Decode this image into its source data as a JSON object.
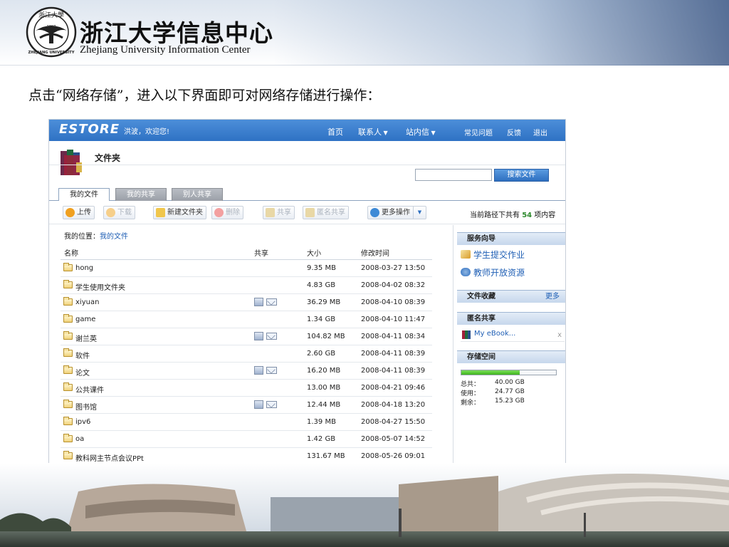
{
  "header": {
    "title_cn": "浙江大学信息中心",
    "title_en": "Zhejiang University Information Center",
    "logo": {
      "text": "浙江大學",
      "year": "1897",
      "ring_text": "ZHEJIANG UNIVERSITY"
    }
  },
  "intro_text": "点击“网络存储”，进入以下界面即可对网络存储进行操作：",
  "estore": {
    "logo": "ESTORE",
    "greeting": "洪波，欢迎您!",
    "nav": {
      "home": "首页",
      "contacts": "联系人",
      "messages": "站内信",
      "faq": "常见问题",
      "feedback": "反馈",
      "logout": "退出"
    },
    "folder_title": "文件夹",
    "search": {
      "value": "",
      "button": "搜索文件"
    },
    "tabs": [
      {
        "label": "我的文件",
        "active": true
      },
      {
        "label": "我的共享",
        "active": false
      },
      {
        "label": "别人共享",
        "active": false
      }
    ],
    "toolbar": {
      "upload": "上传",
      "download": "下载",
      "new_folder": "新建文件夹",
      "delete": "删除",
      "share": "共享",
      "anon_share": "匿名共享",
      "more_ops": "更多操作"
    },
    "path_count": {
      "prefix": "当前路径下共有",
      "count": "54",
      "suffix": "项内容"
    },
    "location": {
      "label": "我的位置：",
      "path": "我的文件"
    },
    "columns": {
      "name": "名称",
      "share": "共享",
      "size": "大小",
      "modified": "修改时间"
    },
    "files": [
      {
        "name": "hong",
        "shared": false,
        "size": "9.35 MB",
        "modified": "2008-03-27 13:50"
      },
      {
        "name": "学生使用文件夹",
        "shared": false,
        "size": "4.83 GB",
        "modified": "2008-04-02 08:32"
      },
      {
        "name": "xiyuan",
        "shared": true,
        "size": "36.29 MB",
        "modified": "2008-04-10 08:39"
      },
      {
        "name": "game",
        "shared": false,
        "size": "1.34 GB",
        "modified": "2008-04-10 11:47"
      },
      {
        "name": "谢兰英",
        "shared": true,
        "size": "104.82 MB",
        "modified": "2008-04-11 08:34"
      },
      {
        "name": "软件",
        "shared": false,
        "size": "2.60 GB",
        "modified": "2008-04-11 08:39"
      },
      {
        "name": "论文",
        "shared": true,
        "size": "16.20 MB",
        "modified": "2008-04-11 08:39"
      },
      {
        "name": "公共课件",
        "shared": false,
        "size": "13.00 MB",
        "modified": "2008-04-21 09:46"
      },
      {
        "name": "图书馆",
        "shared": true,
        "size": "12.44 MB",
        "modified": "2008-04-18 13:20"
      },
      {
        "name": "ipv6",
        "shared": false,
        "size": "1.39 MB",
        "modified": "2008-04-27 15:50"
      },
      {
        "name": "oa",
        "shared": false,
        "size": "1.42 GB",
        "modified": "2008-05-07 14:52"
      },
      {
        "name": "教科网主节点会议PPt",
        "shared": false,
        "size": "131.67 MB",
        "modified": "2008-05-26 09:01"
      }
    ],
    "sidebar": {
      "service_title": "服务向导",
      "service_links": [
        "学生提交作业",
        "教师开放资源"
      ],
      "favorites_title": "文件收藏",
      "favorites_more": "更多",
      "anon_title": "匿名共享",
      "anon_item": "My eBook...",
      "anon_close": "x",
      "storage_title": "存储空间",
      "storage": {
        "used_fraction": 0.62,
        "total_label": "总共：",
        "total": "40.00 GB",
        "used_label": "使用：",
        "used": "24.77 GB",
        "free_label": "剩余：",
        "free": "15.23 GB"
      }
    }
  },
  "colors": {
    "brand_blue": "#2f72c4",
    "link_blue": "#1f5fb5",
    "count_green": "#2d8a2d",
    "meter_green": "#3fb31d"
  }
}
